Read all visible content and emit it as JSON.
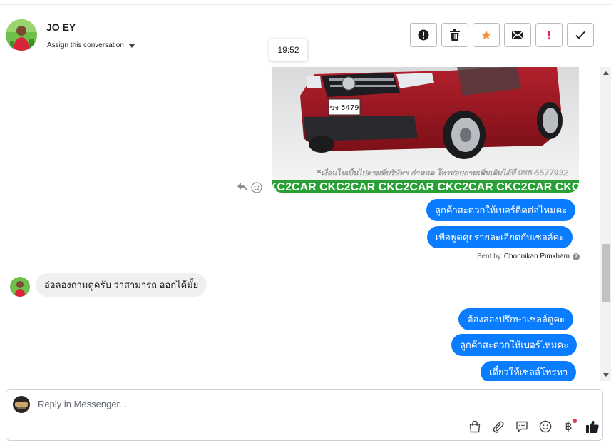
{
  "header": {
    "contact_name": "JO EY",
    "assign_label": "Assign this conversation",
    "actions": [
      {
        "name": "alert-circle-icon",
        "label": "Mark as spam"
      },
      {
        "name": "trash-icon",
        "label": "Delete"
      },
      {
        "name": "star-icon",
        "label": "Star"
      },
      {
        "name": "envelope-icon",
        "label": "Mark as unread"
      },
      {
        "name": "exclamation-icon",
        "label": "Follow up"
      },
      {
        "name": "check-icon",
        "label": "Move to done"
      }
    ],
    "accent_star": "#f7923b",
    "accent_follow": "#e0245e"
  },
  "tooltip": {
    "time": "19:52"
  },
  "image": {
    "plate": "ขจ 5479",
    "caption": "*เงื่อนไขเป็นไปตามที่บริษัทฯ กำหนด โทรสอบถามเพิ่มเติมได้ที่ 088-5577932",
    "banner": "KC2CAR CKC2CAR CKC2CAR CKC2CAR CKC2CAR CKC2"
  },
  "messages": {
    "out_1": "ลูกค้าสะดวกให้เบอร์ติดต่อไหมคะ",
    "out_2": "เพื่อพูดคุยรายละเอียดกับเซลล์คะ",
    "sent_by_prefix": "Sent by",
    "sent_by_name": "Chonnikan Pimkham",
    "in_1": "อ่อลองถามดูครับ ว่าสามารถ ออกได้มั้ย",
    "out_3": "ต้องลองปรึกษาเซลล์ดูคะ",
    "out_4": "ลูกค้าสะดวกให้เบอร์ไหมคะ",
    "out_5": "เดี๋ยวให้เซลล์โทรหา"
  },
  "composer": {
    "placeholder": "Reply in Messenger...",
    "baht_symbol": "฿"
  },
  "colors": {
    "bubble_out": "#0a7cff",
    "bubble_in": "#f0f0f0"
  }
}
